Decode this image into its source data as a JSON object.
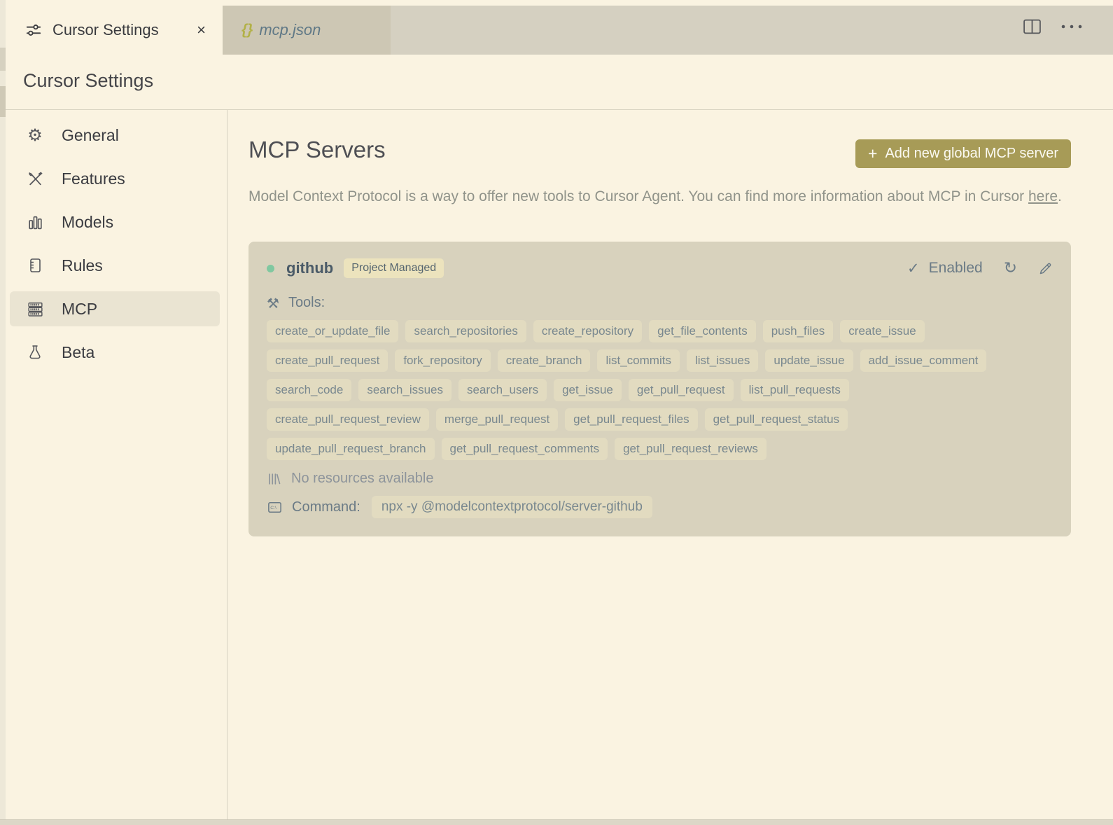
{
  "colors": {
    "background": "#faf3e1",
    "tab_strip": "#d5d0c1",
    "inactive_tab": "#cdc7b4",
    "card_background": "#d8d2bd",
    "tag_background": "#e2dbc0",
    "accent_button": "#a79b57",
    "status_dot_green": "#80c8a0",
    "badge_background": "#ece3bd",
    "slate_text": "#6b7b86",
    "json_braces": "#b2b148"
  },
  "icons": {
    "close": "×",
    "check": "✓",
    "refresh": "↻",
    "plus": "+",
    "braces": "{}",
    "gear": "⚙",
    "tools": "⚒"
  },
  "tab_bar": {
    "active_tab": {
      "label": "Cursor Settings"
    },
    "inactive_tab": {
      "label": "mcp.json"
    }
  },
  "page": {
    "heading": "Cursor Settings"
  },
  "sidebar": {
    "items": [
      {
        "label": "General"
      },
      {
        "label": "Features"
      },
      {
        "label": "Models"
      },
      {
        "label": "Rules"
      },
      {
        "label": "MCP",
        "selected": true
      },
      {
        "label": "Beta"
      }
    ]
  },
  "main": {
    "title": "MCP Servers",
    "add_button_label": "Add new global MCP server",
    "description_text": "Model Context Protocol is a way to offer new tools to Cursor Agent. You can find more information about MCP in Cursor",
    "description_link": "here",
    "description_suffix": "."
  },
  "server_card": {
    "name": "github",
    "badge": "Project Managed",
    "status": "Enabled",
    "tools_label": "Tools:",
    "tool_rows": [
      [
        "create_or_update_file",
        "search_repositories",
        "create_repository",
        "get_file_contents",
        "push_files",
        "create_issue"
      ],
      [
        "create_pull_request",
        "fork_repository",
        "create_branch",
        "list_commits",
        "list_issues",
        "update_issue",
        "add_issue_comment"
      ],
      [
        "search_code",
        "search_issues",
        "search_users",
        "get_issue",
        "get_pull_request",
        "list_pull_requests"
      ],
      [
        "create_pull_request_review",
        "merge_pull_request",
        "get_pull_request_files",
        "get_pull_request_status"
      ],
      [
        "update_pull_request_branch",
        "get_pull_request_comments",
        "get_pull_request_reviews"
      ]
    ],
    "resources_text": "No resources available",
    "command_label": "Command:",
    "command_value": "npx -y @modelcontextprotocol/server-github"
  }
}
